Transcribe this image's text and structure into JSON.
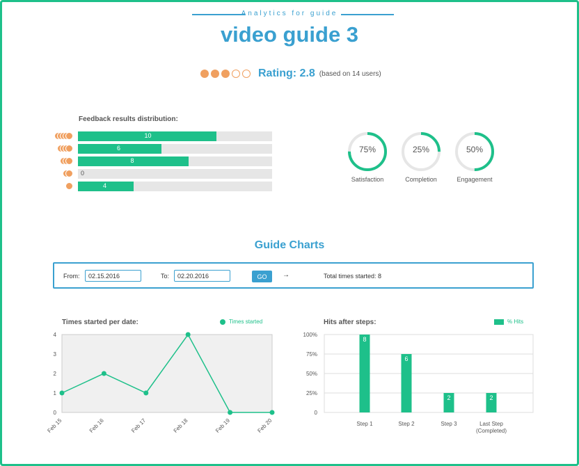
{
  "header": {
    "kicker": "Analytics for guide",
    "title": "video guide 3"
  },
  "rating": {
    "filled": 3,
    "total": 5,
    "label": "Rating: 2.8",
    "sub": "(based on 14 users)"
  },
  "feedback": {
    "title": "Feedback results distribution:",
    "max": 14,
    "rows": [
      {
        "dots": 5,
        "value": 10
      },
      {
        "dots": 4,
        "value": 6
      },
      {
        "dots": 3,
        "value": 8
      },
      {
        "dots": 2,
        "value": 0
      },
      {
        "dots": 1,
        "value": 4
      }
    ]
  },
  "donuts": [
    {
      "percent": 75,
      "label": "75%",
      "name": "Satisfaction"
    },
    {
      "percent": 25,
      "label": "25%",
      "name": "Completion"
    },
    {
      "percent": 50,
      "label": "50%",
      "name": "Engagement"
    }
  ],
  "charts_section": {
    "title": "Guide Charts"
  },
  "filter": {
    "from_label": "From:",
    "from_value": "02.15.2016",
    "to_label": "To:",
    "to_value": "02.20.2016",
    "go_label": "GO",
    "arrow": "→",
    "total_text": "Total times started: 8"
  },
  "colors": {
    "accent": "#1ec08a",
    "brand_blue": "#3aa0d0",
    "rating_orange": "#f0a060"
  },
  "chart_data": [
    {
      "type": "line",
      "title": "Times started per date:",
      "x": [
        "Feb 15",
        "Feb 16",
        "Feb 17",
        "Feb 18",
        "Feb 19",
        "Feb 20"
      ],
      "series": [
        {
          "name": "Times started",
          "values": [
            1,
            2,
            1,
            4,
            0,
            0
          ]
        }
      ],
      "yticks": [
        "0",
        "1",
        "2",
        "3",
        "4"
      ],
      "ylim": [
        0,
        4
      ],
      "grid": false,
      "legend": "top-right"
    },
    {
      "type": "bar",
      "title": "Hits after steps:",
      "categories": [
        "Step 1",
        "Step 2",
        "Step 3",
        "Last Step|(Completed)"
      ],
      "series": [
        {
          "name": "% Hits",
          "values": [
            100,
            75,
            25,
            25
          ],
          "labels": [
            "8",
            "6",
            "2",
            "2"
          ]
        }
      ],
      "yticks": [
        "0",
        "25%",
        "50%",
        "75%",
        "100%"
      ],
      "ylim": [
        0,
        100
      ],
      "grid": true,
      "legend": "top-right"
    }
  ]
}
